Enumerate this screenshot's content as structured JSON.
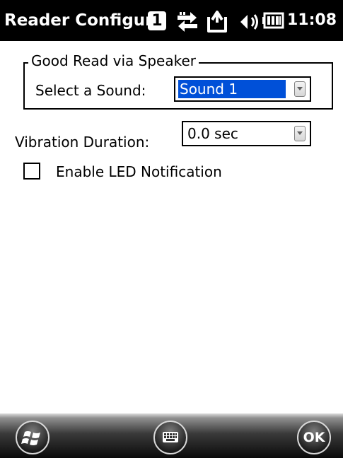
{
  "app": {
    "title": "Reader Configur"
  },
  "status_bar": {
    "badge": "1",
    "time": "11:08",
    "icons": [
      "connectivity-icon",
      "message-icon",
      "volume-icon",
      "battery-icon"
    ]
  },
  "good_read": {
    "group_label": "Good Read via Speaker",
    "sound_label": "Select a Sound:",
    "sound_value": "Sound 1"
  },
  "vibration": {
    "label": "Vibration Duration:",
    "value": "0.0 sec"
  },
  "led": {
    "label": "Enable LED Notification",
    "checked": false
  },
  "soft_keys": {
    "ok_label": "OK",
    "left_icon": "windows-start-icon",
    "center_icon": "keyboard-icon"
  },
  "colors": {
    "selection": "#0050d8",
    "title_bar": "#000000"
  }
}
